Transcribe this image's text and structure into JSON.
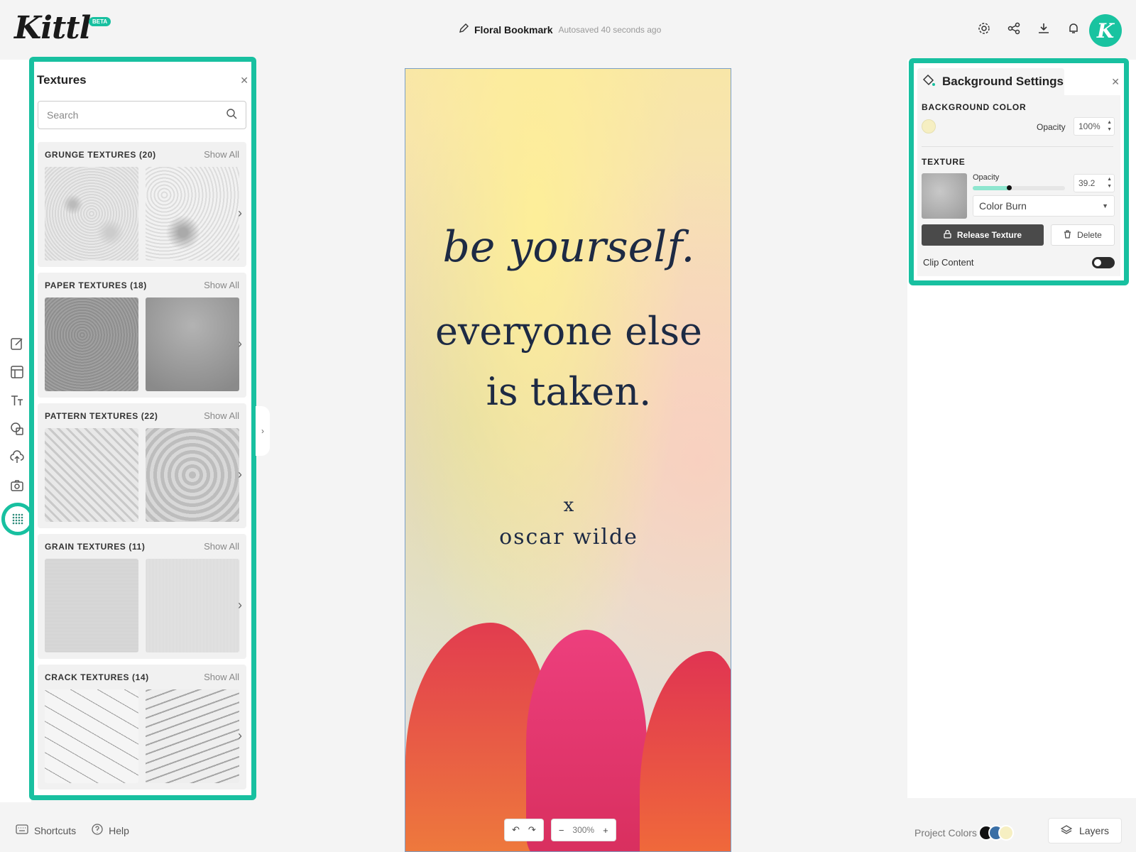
{
  "app": {
    "logo_text": "Kittl",
    "beta_badge": "BETA",
    "avatar_letter": "K",
    "accent_color": "#18c0a0"
  },
  "header": {
    "doc_name": "Floral Bookmark",
    "autosave_status": "Autosaved 40 seconds ago",
    "icons": [
      "gear-icon",
      "share-icon",
      "download-icon",
      "bell-icon"
    ]
  },
  "left_rail": {
    "icons": [
      "edit-icon",
      "layout-icon",
      "text-icon",
      "shapes-icon",
      "upload-icon",
      "camera-icon",
      "texture-icon"
    ],
    "active": "texture-icon"
  },
  "textures_panel": {
    "title": "Textures",
    "search_placeholder": "Search",
    "categories": [
      {
        "title": "GRUNGE TEXTURES (20)",
        "show_all": "Show All"
      },
      {
        "title": "PAPER TEXTURES (18)",
        "show_all": "Show All"
      },
      {
        "title": "PATTERN TEXTURES (22)",
        "show_all": "Show All"
      },
      {
        "title": "GRAIN TEXTURES (11)",
        "show_all": "Show All"
      },
      {
        "title": "CRACK TEXTURES (14)",
        "show_all": "Show All"
      }
    ]
  },
  "canvas": {
    "script_line": "be yourself.",
    "line2": "everyone else",
    "line3": "is taken.",
    "separator": "x",
    "author": "oscar wilde"
  },
  "background_settings": {
    "title": "Background Settings",
    "bg_color_label": "BACKGROUND COLOR",
    "bg_color": "#f6efc2",
    "opacity_label": "Opacity",
    "bg_opacity": "100%",
    "texture_label": "TEXTURE",
    "texture_opacity_label": "Opacity",
    "texture_opacity": "39.2",
    "texture_opacity_fraction": 0.392,
    "blend_mode": "Color Burn",
    "release_button": "Release Texture",
    "delete_button": "Delete",
    "clip_content_label": "Clip Content",
    "clip_content_on": false
  },
  "bottom_bar": {
    "shortcuts": "Shortcuts",
    "help": "Help",
    "zoom": "300%",
    "project_colors": "Project Colors",
    "project_color_swatches": [
      "#111111",
      "#3a6fa6",
      "#f6efc2"
    ],
    "layers": "Layers"
  }
}
